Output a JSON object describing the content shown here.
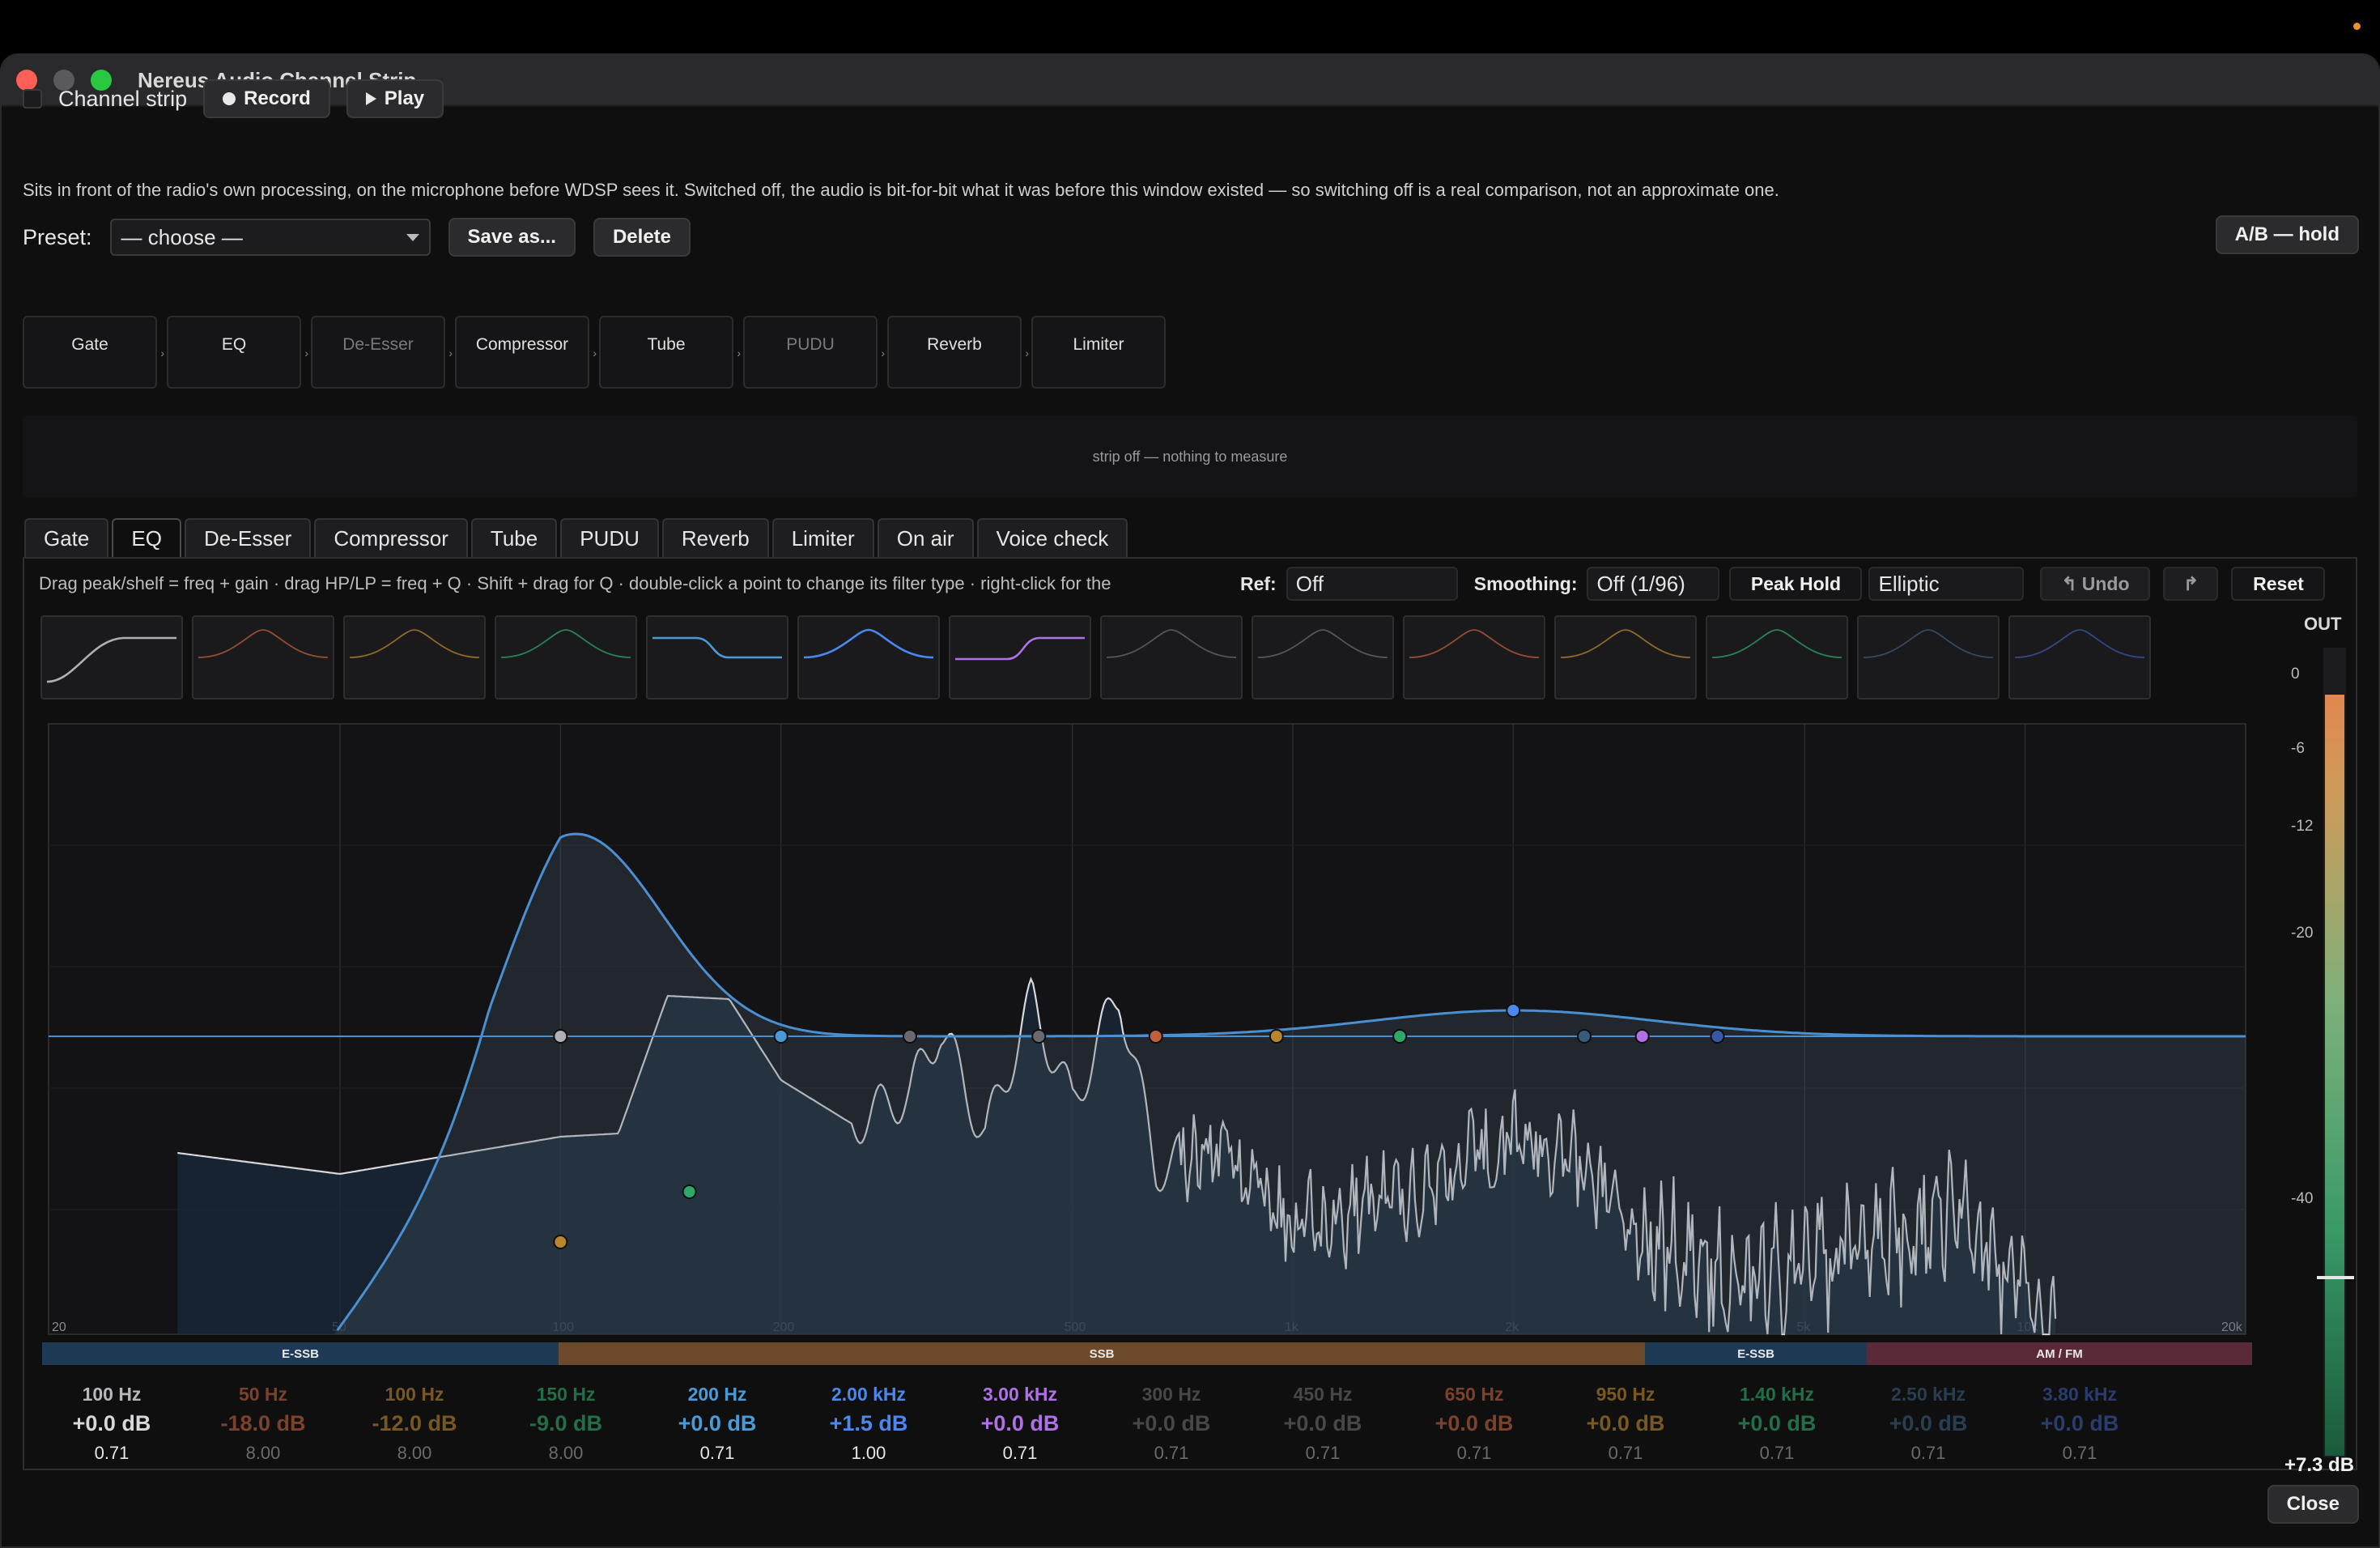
{
  "window": {
    "title": "Nereus Audio Channel Strip"
  },
  "header": {
    "channel_strip_label": "Channel strip",
    "record_label": "Record",
    "play_label": "Play",
    "description": "Sits in front of the radio's own processing, on the microphone before WDSP sees it. Switched off, the audio is bit-for-bit what it was before this window existed — so switching off is a real comparison, not an approximate one.",
    "preset_label": "Preset:",
    "preset_value": "— choose —",
    "save_as_label": "Save as...",
    "delete_label": "Delete",
    "ab_label": "A/B — hold"
  },
  "chain": [
    {
      "name": "Gate",
      "enabled": true
    },
    {
      "name": "EQ",
      "enabled": true
    },
    {
      "name": "De-Esser",
      "enabled": false
    },
    {
      "name": "Compressor",
      "enabled": true
    },
    {
      "name": "Tube",
      "enabled": true
    },
    {
      "name": "PUDU",
      "enabled": false
    },
    {
      "name": "Reverb",
      "enabled": true
    },
    {
      "name": "Limiter",
      "enabled": true
    }
  ],
  "meter_status": "strip off — nothing to measure",
  "tabs": [
    "Gate",
    "EQ",
    "De-Esser",
    "Compressor",
    "Tube",
    "PUDU",
    "Reverb",
    "Limiter",
    "On air",
    "Voice check"
  ],
  "active_tab": "EQ",
  "eq": {
    "hint": "Drag peak/shelf = freq + gain · drag HP/LP = freq + Q · Shift + drag for Q · double-click a point to change its filter type · right-click for the",
    "ref_label": "Ref:",
    "ref_value": "Off",
    "smoothing_label": "Smoothing:",
    "smoothing_value": "Off (1/96)",
    "peak_hold_label": "Peak Hold",
    "filter_design": "Elliptic",
    "undo_label": "Undo",
    "redo_icon": "redo-icon",
    "reset_label": "Reset",
    "freq_axis_labels": [
      "20",
      "50",
      "100",
      "200",
      "500",
      "1k",
      "2k",
      "5k",
      "10k",
      "20k"
    ],
    "band_regions": [
      {
        "label": "E-SSB",
        "color": "#1f3a55"
      },
      {
        "label": "SSB",
        "color": "#6e4a2c"
      },
      {
        "label": "E-SSB",
        "color": "#1f3a55"
      },
      {
        "label": "AM / FM",
        "color": "#5a2a38"
      }
    ],
    "bands": [
      {
        "freq": "100 Hz",
        "gain": "+0.0 dB",
        "q": "0.71",
        "color": "#b0b0b4",
        "active": true,
        "type": "highpass"
      },
      {
        "freq": "50 Hz",
        "gain": "-18.0 dB",
        "q": "8.00",
        "color": "#c0603a",
        "active": false,
        "type": "peak"
      },
      {
        "freq": "100 Hz",
        "gain": "-12.0 dB",
        "q": "8.00",
        "color": "#b8862e",
        "active": false,
        "type": "peak"
      },
      {
        "freq": "150 Hz",
        "gain": "-9.0 dB",
        "q": "8.00",
        "color": "#2ea86a",
        "active": false,
        "type": "peak"
      },
      {
        "freq": "200 Hz",
        "gain": "+0.0 dB",
        "q": "0.71",
        "color": "#4a9ad8",
        "active": true,
        "type": "lowshelf"
      },
      {
        "freq": "2.00 kHz",
        "gain": "+1.5 dB",
        "q": "1.00",
        "color": "#4a88f0",
        "active": true,
        "type": "peak"
      },
      {
        "freq": "3.00 kHz",
        "gain": "+0.0 dB",
        "q": "0.71",
        "color": "#b070e8",
        "active": true,
        "type": "highshelf"
      },
      {
        "freq": "300 Hz",
        "gain": "+0.0 dB",
        "q": "0.71",
        "color": "#6a6a6e",
        "active": false,
        "type": "peak"
      },
      {
        "freq": "450 Hz",
        "gain": "+0.0 dB",
        "q": "0.71",
        "color": "#6a6a6e",
        "active": false,
        "type": "peak"
      },
      {
        "freq": "650 Hz",
        "gain": "+0.0 dB",
        "q": "0.71",
        "color": "#c0603a",
        "active": false,
        "type": "peak"
      },
      {
        "freq": "950 Hz",
        "gain": "+0.0 dB",
        "q": "0.71",
        "color": "#b8862e",
        "active": false,
        "type": "peak"
      },
      {
        "freq": "1.40 kHz",
        "gain": "+0.0 dB",
        "q": "0.71",
        "color": "#2ea86a",
        "active": false,
        "type": "peak"
      },
      {
        "freq": "2.50 kHz",
        "gain": "+0.0 dB",
        "q": "0.71",
        "color": "#3a5a7a",
        "active": false,
        "type": "peak"
      },
      {
        "freq": "3.80 kHz",
        "gain": "+0.0 dB",
        "q": "0.71",
        "color": "#3a58a8",
        "active": false,
        "type": "peak"
      }
    ],
    "output": {
      "label": "OUT",
      "ticks": [
        "0",
        "-6",
        "-12",
        "-20",
        "-40"
      ],
      "value": "+7.3 dB",
      "level_fraction": 0.94
    }
  },
  "close_label": "Close"
}
